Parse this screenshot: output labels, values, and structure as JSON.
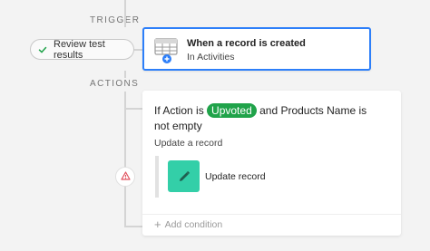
{
  "sections": {
    "trigger": "TRIGGER",
    "actions": "ACTIONS"
  },
  "review_button": {
    "label": "Review test results",
    "icon": "check-icon"
  },
  "trigger_card": {
    "icon": "table-icon",
    "title": "When a record is created",
    "subtitle": "In Activities"
  },
  "action_card": {
    "condition_prefix": "If Action is",
    "condition_value": "Upvoted",
    "condition_suffix": "and Products Name is not empty",
    "update_label": "Update a record",
    "step_label": "Update record",
    "step_icon": "pencil-icon",
    "add_condition": "Add condition"
  },
  "warning": {
    "icon": "warning-icon"
  },
  "colors": {
    "accent": "#2d7ff9",
    "badge": "#20a34a",
    "step_icon_bg": "#33cfa8",
    "warning": "#e0525e"
  }
}
